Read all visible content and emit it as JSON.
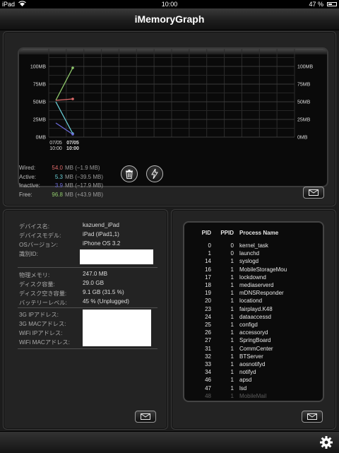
{
  "status_bar": {
    "carrier": "iPad",
    "time": "10:00",
    "battery": "47 %"
  },
  "nav": {
    "title": "iMemoryGraph"
  },
  "chart_data": {
    "type": "line",
    "y_ticks_left": [
      "100MB",
      "75MB",
      "50MB",
      "25MB",
      "0MB"
    ],
    "y_ticks_right": [
      "100MB",
      "75MB",
      "50MB",
      "25MB",
      "0MB"
    ],
    "ylim": [
      0,
      125
    ],
    "x_ticks": [
      {
        "date": "07/05",
        "time": "10:00"
      },
      {
        "date": "07/05",
        "time": "10:00"
      }
    ],
    "series": [
      {
        "values": [
          52,
          98
        ],
        "color": "#8fc96b"
      },
      {
        "values": [
          52,
          54
        ],
        "color": "#e06a6a"
      },
      {
        "values": [
          50,
          5
        ],
        "color": "#6ad0d8"
      },
      {
        "values": [
          20,
          4
        ],
        "color": "#6b6ad8"
      }
    ]
  },
  "memory": {
    "rows": [
      {
        "label": "Wired:",
        "value": "54.0",
        "color": "#e06a6a",
        "unit": "MB (−1.9 MB)"
      },
      {
        "label": "Active:",
        "value": "5.3",
        "color": "#6ad0d8",
        "unit": "MB (−39.5 MB)"
      },
      {
        "label": "Inactive:",
        "value": "3.9",
        "color": "#6b6ad8",
        "unit": "MB (−17.9 MB)"
      },
      {
        "label": "Free:",
        "value": "96.8",
        "color": "#8fc96b",
        "unit": "MB (+43.9 MB)"
      }
    ]
  },
  "device": {
    "labels": [
      "デバイス名:",
      "デバイスモデル:",
      "OSバージョン:",
      "識別ID:"
    ],
    "values": [
      "kazuend_iPad",
      "iPad (iPad1,1)",
      "iPhone OS 3.2"
    ],
    "labels2": [
      "物理メモリ:",
      "ディスク容量:",
      "ディスク空き容量:",
      "バッテリーレベル:"
    ],
    "values2": [
      "247.0 MB",
      "29.0 GB",
      "9.1 GB (31.5 %)",
      "45 % (Unplugged)"
    ],
    "labels3": [
      "3G IPアドレス:",
      "3G MACアドレス:",
      "WiFi IPアドレス:",
      "WiFi MACアドレス:"
    ]
  },
  "process": {
    "headers": {
      "pid": "PID",
      "ppid": "PPID",
      "name": "Process Name"
    },
    "rows": [
      [
        "0",
        "0",
        "kernel_task"
      ],
      [
        "1",
        "0",
        "launchd"
      ],
      [
        "14",
        "1",
        "syslogd"
      ],
      [
        "16",
        "1",
        "MobileStorageMou"
      ],
      [
        "17",
        "1",
        "lockdownd"
      ],
      [
        "18",
        "1",
        "mediaserverd"
      ],
      [
        "19",
        "1",
        "mDNSResponder"
      ],
      [
        "20",
        "1",
        "locationd"
      ],
      [
        "23",
        "1",
        "fairplayd.K48"
      ],
      [
        "24",
        "1",
        "dataaccessd"
      ],
      [
        "25",
        "1",
        "configd"
      ],
      [
        "26",
        "1",
        "accessoryd"
      ],
      [
        "27",
        "1",
        "SpringBoard"
      ],
      [
        "31",
        "1",
        "CommCenter"
      ],
      [
        "32",
        "1",
        "BTServer"
      ],
      [
        "33",
        "1",
        "aosnotifyd"
      ],
      [
        "34",
        "1",
        "notifyd"
      ],
      [
        "46",
        "1",
        "apsd"
      ],
      [
        "47",
        "1",
        "lsd"
      ],
      [
        "48",
        "1",
        "MobileMail"
      ]
    ]
  }
}
